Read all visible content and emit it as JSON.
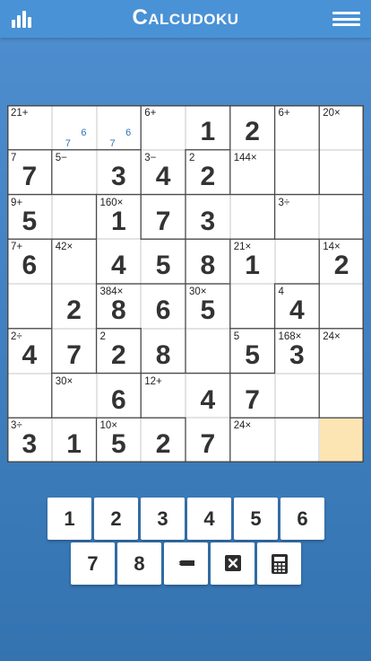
{
  "header": {
    "title": "Calcudoku"
  },
  "grid": {
    "size": 8,
    "selected": [
      7,
      7
    ],
    "cages": [
      {
        "clue": "21+",
        "cells": [
          [
            0,
            0
          ],
          [
            0,
            1
          ],
          [
            0,
            2
          ]
        ]
      },
      {
        "clue": "6+",
        "cells": [
          [
            0,
            3
          ],
          [
            0,
            4
          ],
          [
            1,
            3
          ]
        ]
      },
      {
        "clue": "",
        "cells": [
          [
            0,
            5
          ],
          [
            1,
            5
          ]
        ]
      },
      {
        "clue": "6+",
        "cells": [
          [
            0,
            6
          ],
          [
            1,
            6
          ]
        ]
      },
      {
        "clue": "20×",
        "cells": [
          [
            0,
            7
          ],
          [
            1,
            7
          ]
        ]
      },
      {
        "clue": "7",
        "cells": [
          [
            1,
            0
          ]
        ]
      },
      {
        "clue": "5−",
        "cells": [
          [
            1,
            1
          ],
          [
            1,
            2
          ]
        ]
      },
      {
        "clue": "3−",
        "cells": [
          [
            1,
            3
          ],
          [
            2,
            3
          ]
        ]
      },
      {
        "clue": "2",
        "cells": [
          [
            1,
            4
          ]
        ]
      },
      {
        "clue": "144×",
        "cells": [
          [
            1,
            5
          ],
          [
            2,
            5
          ],
          [
            2,
            4
          ]
        ]
      },
      {
        "clue": "9+",
        "cells": [
          [
            2,
            0
          ],
          [
            2,
            1
          ]
        ]
      },
      {
        "clue": "160×",
        "cells": [
          [
            2,
            2
          ],
          [
            3,
            2
          ],
          [
            3,
            3
          ]
        ]
      },
      {
        "clue": "3÷",
        "cells": [
          [
            2,
            6
          ],
          [
            2,
            7
          ]
        ]
      },
      {
        "clue": "7+",
        "cells": [
          [
            3,
            0
          ],
          [
            4,
            0
          ]
        ]
      },
      {
        "clue": "42×",
        "cells": [
          [
            3,
            1
          ],
          [
            4,
            1
          ],
          [
            5,
            1
          ]
        ]
      },
      {
        "clue": "",
        "cells": [
          [
            3,
            4
          ],
          [
            3,
            3
          ]
        ]
      },
      {
        "clue": "21×",
        "cells": [
          [
            3,
            5
          ],
          [
            3,
            6
          ],
          [
            4,
            5
          ]
        ]
      },
      {
        "clue": "14×",
        "cells": [
          [
            3,
            7
          ],
          [
            4,
            7
          ]
        ]
      },
      {
        "clue": "384×",
        "cells": [
          [
            4,
            2
          ],
          [
            4,
            3
          ],
          [
            5,
            3
          ]
        ]
      },
      {
        "clue": "30×",
        "cells": [
          [
            4,
            4
          ],
          [
            5,
            4
          ]
        ]
      },
      {
        "clue": "4",
        "cells": [
          [
            4,
            6
          ]
        ]
      },
      {
        "clue": "2÷",
        "cells": [
          [
            5,
            0
          ],
          [
            6,
            0
          ]
        ]
      },
      {
        "clue": "2",
        "cells": [
          [
            5,
            2
          ]
        ]
      },
      {
        "clue": "5",
        "cells": [
          [
            5,
            5
          ]
        ]
      },
      {
        "clue": "168×",
        "cells": [
          [
            5,
            6
          ],
          [
            6,
            6
          ],
          [
            6,
            5
          ]
        ]
      },
      {
        "clue": "24×",
        "cells": [
          [
            5,
            7
          ],
          [
            6,
            7
          ]
        ]
      },
      {
        "clue": "30×",
        "cells": [
          [
            6,
            1
          ],
          [
            6,
            2
          ]
        ]
      },
      {
        "clue": "12+",
        "cells": [
          [
            6,
            3
          ],
          [
            6,
            4
          ],
          [
            7,
            4
          ]
        ]
      },
      {
        "clue": "3÷",
        "cells": [
          [
            7,
            0
          ],
          [
            7,
            1
          ]
        ]
      },
      {
        "clue": "10×",
        "cells": [
          [
            7,
            2
          ],
          [
            7,
            3
          ]
        ]
      },
      {
        "clue": "24×",
        "cells": [
          [
            7,
            5
          ],
          [
            7,
            6
          ],
          [
            7,
            7
          ]
        ]
      }
    ],
    "rows": [
      [
        {
          "clue": "21+",
          "value": ""
        },
        {
          "clue": "",
          "value": "",
          "notes": [
            "6",
            "7"
          ]
        },
        {
          "clue": "",
          "value": "",
          "notes": [
            "6",
            "7"
          ]
        },
        {
          "clue": "6+",
          "value": ""
        },
        {
          "clue": "",
          "value": "1"
        },
        {
          "clue": "",
          "value": "2"
        },
        {
          "clue": "6+",
          "value": ""
        },
        {
          "clue": "20×",
          "value": ""
        }
      ],
      [
        {
          "clue": "7",
          "value": "7"
        },
        {
          "clue": "5−",
          "value": ""
        },
        {
          "clue": "",
          "value": "3"
        },
        {
          "clue": "3−",
          "value": "4"
        },
        {
          "clue": "2",
          "value": "2"
        },
        {
          "clue": "144×",
          "value": ""
        },
        {
          "clue": "",
          "value": ""
        },
        {
          "clue": "",
          "value": ""
        }
      ],
      [
        {
          "clue": "9+",
          "value": "5"
        },
        {
          "clue": "",
          "value": ""
        },
        {
          "clue": "160×",
          "value": "1"
        },
        {
          "clue": "",
          "value": "7"
        },
        {
          "clue": "",
          "value": "3"
        },
        {
          "clue": "",
          "value": ""
        },
        {
          "clue": "3÷",
          "value": ""
        },
        {
          "clue": "",
          "value": ""
        }
      ],
      [
        {
          "clue": "7+",
          "value": "6"
        },
        {
          "clue": "42×",
          "value": ""
        },
        {
          "clue": "",
          "value": "4"
        },
        {
          "clue": "",
          "value": "5"
        },
        {
          "clue": "",
          "value": "8"
        },
        {
          "clue": "21×",
          "value": "1"
        },
        {
          "clue": "",
          "value": ""
        },
        {
          "clue": "14×",
          "value": "2"
        }
      ],
      [
        {
          "clue": "",
          "value": ""
        },
        {
          "clue": "",
          "value": "2"
        },
        {
          "clue": "384×",
          "value": "8"
        },
        {
          "clue": "",
          "value": "6"
        },
        {
          "clue": "30×",
          "value": "5"
        },
        {
          "clue": "",
          "value": ""
        },
        {
          "clue": "4",
          "value": "4"
        },
        {
          "clue": "",
          "value": ""
        }
      ],
      [
        {
          "clue": "2÷",
          "value": "4"
        },
        {
          "clue": "",
          "value": "7"
        },
        {
          "clue": "2",
          "value": "2"
        },
        {
          "clue": "",
          "value": "8"
        },
        {
          "clue": "",
          "value": ""
        },
        {
          "clue": "5",
          "value": "5"
        },
        {
          "clue": "168×",
          "value": "3"
        },
        {
          "clue": "24×",
          "value": ""
        }
      ],
      [
        {
          "clue": "",
          "value": ""
        },
        {
          "clue": "30×",
          "value": ""
        },
        {
          "clue": "",
          "value": "6"
        },
        {
          "clue": "12+",
          "value": ""
        },
        {
          "clue": "",
          "value": "4"
        },
        {
          "clue": "",
          "value": "7"
        },
        {
          "clue": "",
          "value": ""
        },
        {
          "clue": "",
          "value": ""
        }
      ],
      [
        {
          "clue": "3÷",
          "value": "3"
        },
        {
          "clue": "",
          "value": "1"
        },
        {
          "clue": "10×",
          "value": "5"
        },
        {
          "clue": "",
          "value": "2"
        },
        {
          "clue": "",
          "value": "7"
        },
        {
          "clue": "24×",
          "value": ""
        },
        {
          "clue": "",
          "value": ""
        },
        {
          "clue": "",
          "value": ""
        }
      ]
    ]
  },
  "keypad": {
    "digits_row1": [
      "1",
      "2",
      "3",
      "4",
      "5",
      "6"
    ],
    "digits_row2": [
      "7",
      "8"
    ],
    "tools": [
      {
        "name": "pencil-key",
        "icon": "pencil-icon"
      },
      {
        "name": "clear-key",
        "icon": "delete-icon"
      },
      {
        "name": "calculator-key",
        "icon": "calculator-icon"
      }
    ]
  },
  "colors": {
    "background": "#3f7fbf",
    "header": "#4a92d6",
    "selected_cell": "#fde4b3",
    "note": "#2e72b8"
  }
}
